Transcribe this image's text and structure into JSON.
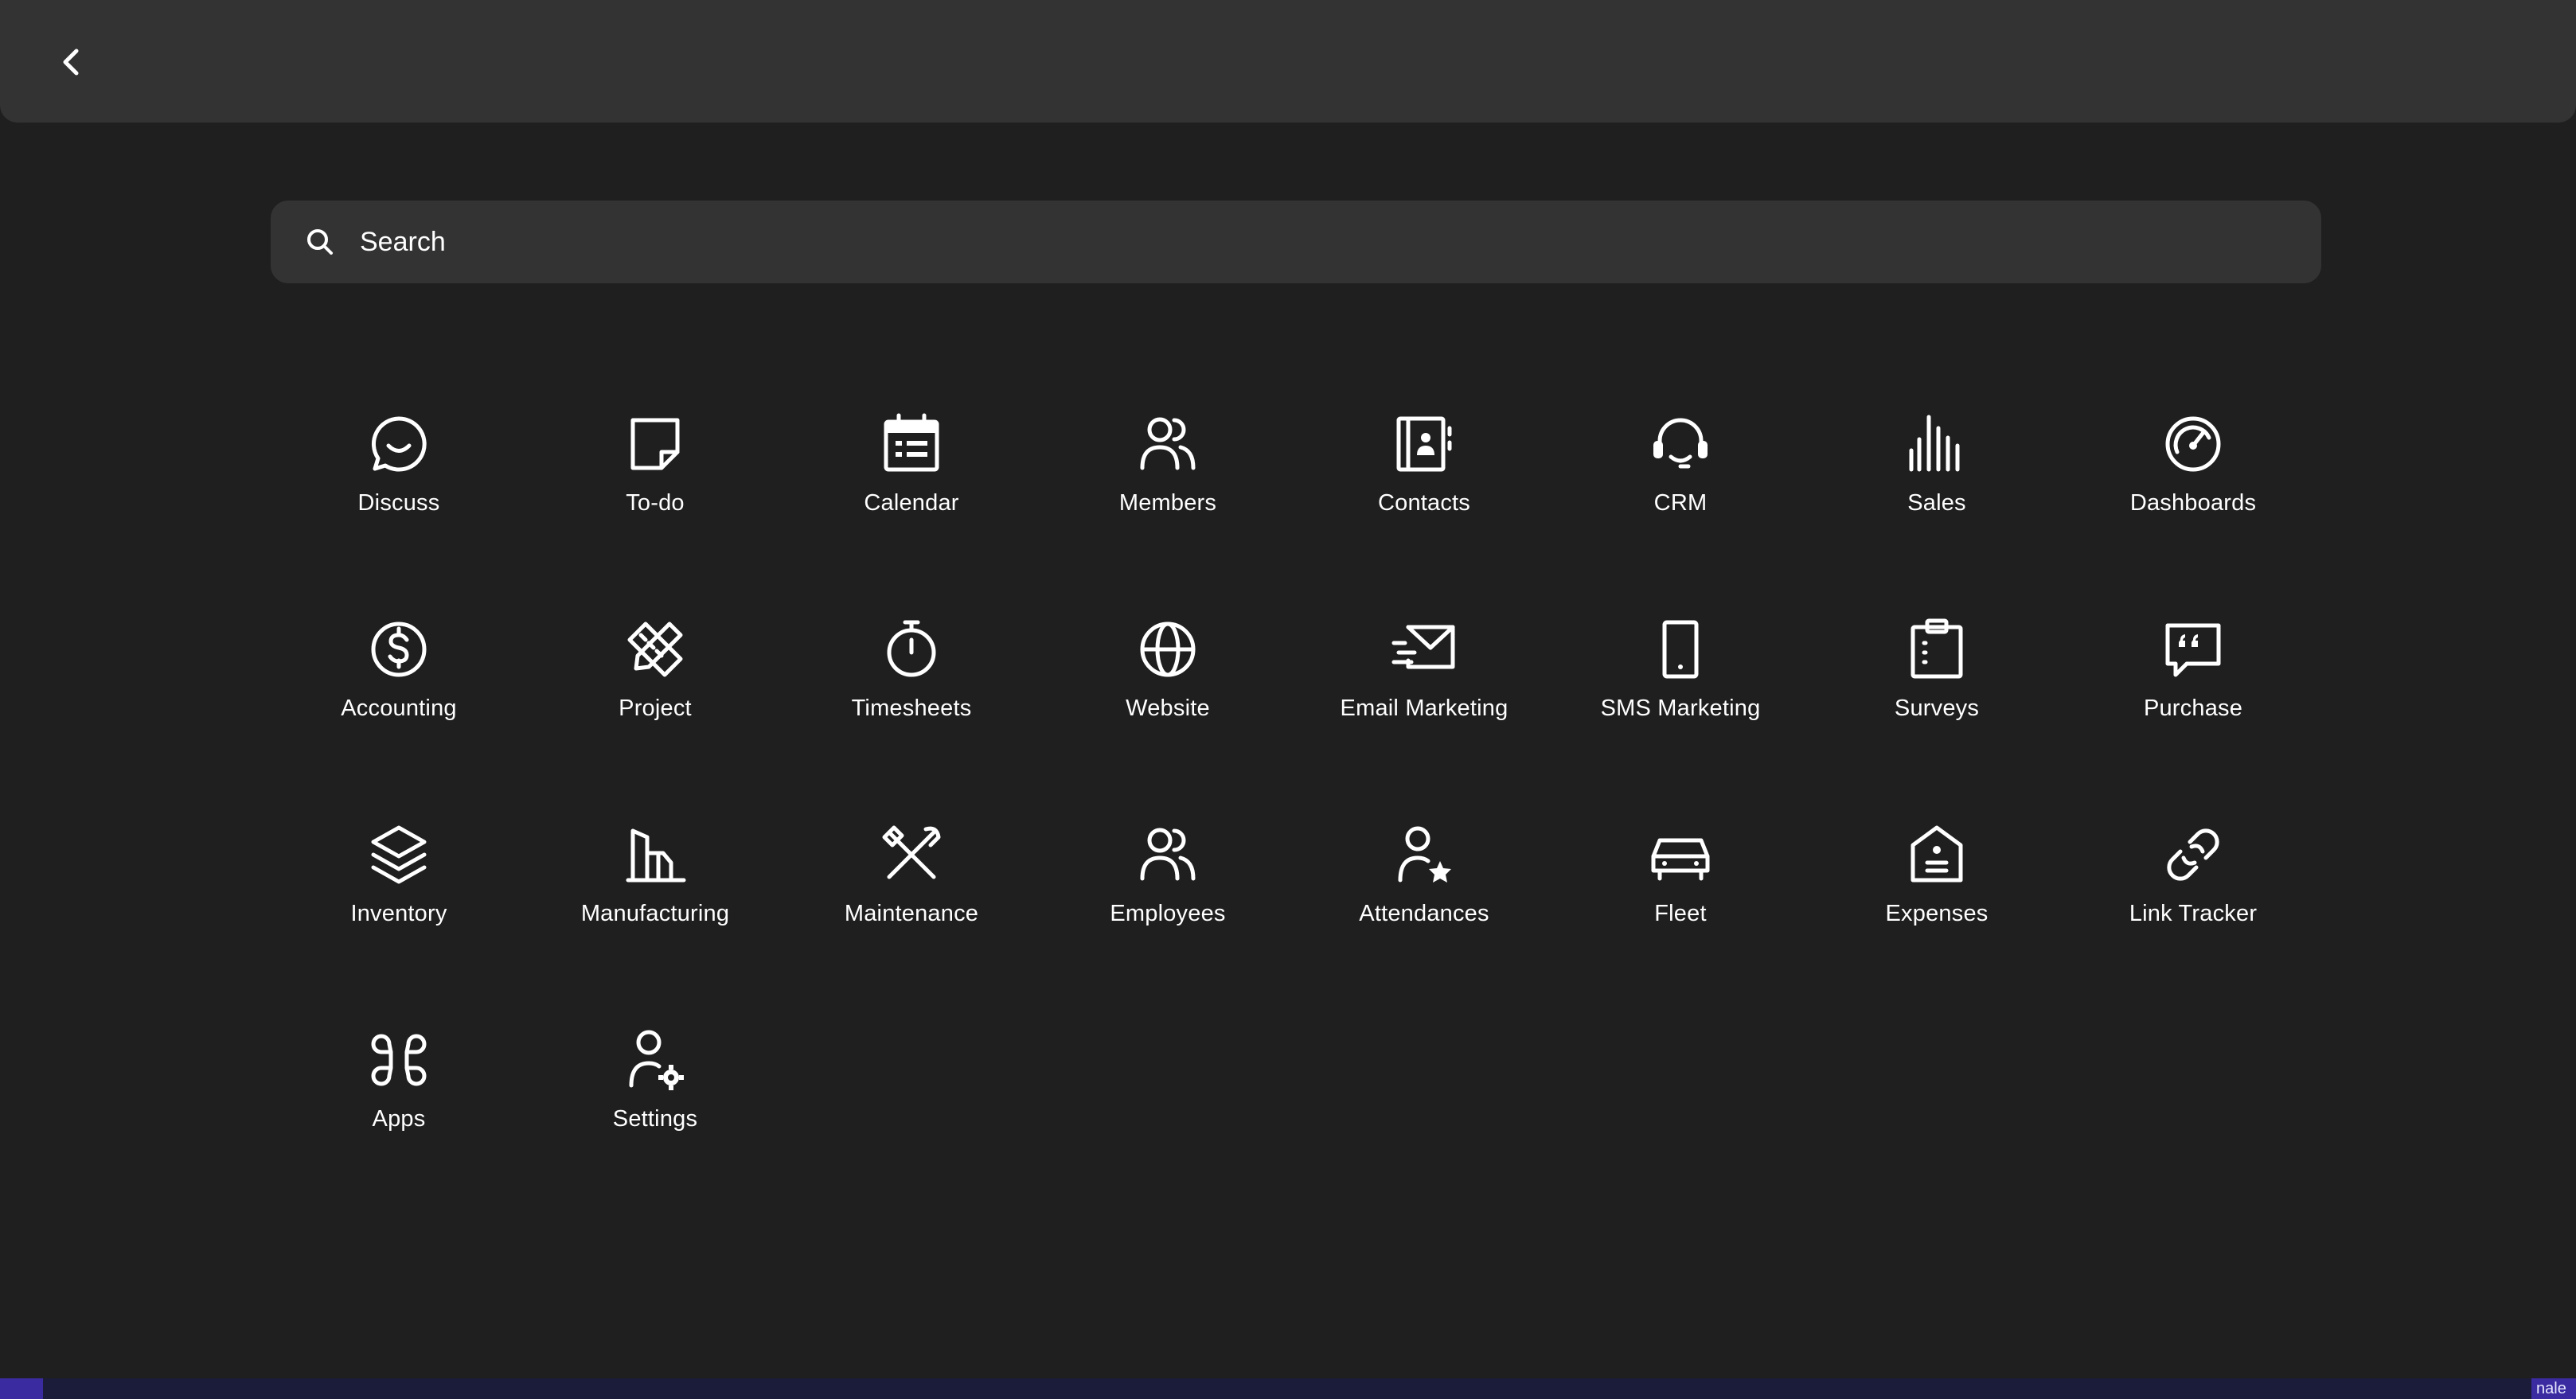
{
  "header": {
    "back_icon": "chevron-left-icon"
  },
  "search": {
    "placeholder": "Search",
    "value": "",
    "icon": "search-icon"
  },
  "apps": [
    {
      "label": "Discuss",
      "icon": "chat-bubble-icon"
    },
    {
      "label": "To-do",
      "icon": "sticky-note-icon"
    },
    {
      "label": "Calendar",
      "icon": "calendar-icon"
    },
    {
      "label": "Members",
      "icon": "users-icon"
    },
    {
      "label": "Contacts",
      "icon": "address-book-icon"
    },
    {
      "label": "CRM",
      "icon": "headset-icon"
    },
    {
      "label": "Sales",
      "icon": "bar-chart-icon"
    },
    {
      "label": "Dashboards",
      "icon": "gauge-icon"
    },
    {
      "label": "Accounting",
      "icon": "dollar-coin-icon"
    },
    {
      "label": "Project",
      "icon": "ruler-pencil-icon"
    },
    {
      "label": "Timesheets",
      "icon": "stopwatch-icon"
    },
    {
      "label": "Website",
      "icon": "globe-icon"
    },
    {
      "label": "Email Marketing",
      "icon": "envelope-send-icon"
    },
    {
      "label": "SMS Marketing",
      "icon": "mobile-phone-icon"
    },
    {
      "label": "Surveys",
      "icon": "clipboard-icon"
    },
    {
      "label": "Purchase",
      "icon": "quote-bubble-icon"
    },
    {
      "label": "Inventory",
      "icon": "layers-icon"
    },
    {
      "label": "Manufacturing",
      "icon": "factory-icon"
    },
    {
      "label": "Maintenance",
      "icon": "tools-icon"
    },
    {
      "label": "Employees",
      "icon": "users-icon"
    },
    {
      "label": "Attendances",
      "icon": "user-star-icon"
    },
    {
      "label": "Fleet",
      "icon": "car-icon"
    },
    {
      "label": "Expenses",
      "icon": "receipt-tag-icon"
    },
    {
      "label": "Link Tracker",
      "icon": "link-icon"
    },
    {
      "label": "Apps",
      "icon": "command-icon"
    },
    {
      "label": "Settings",
      "icon": "user-gear-icon"
    }
  ],
  "taskbar": {
    "right_text": "nale"
  },
  "colors": {
    "background": "#1f1f1f",
    "panel": "#333333",
    "text": "#ffffff",
    "taskbar": "#1b1b3a",
    "accent": "#3b2ba0"
  }
}
